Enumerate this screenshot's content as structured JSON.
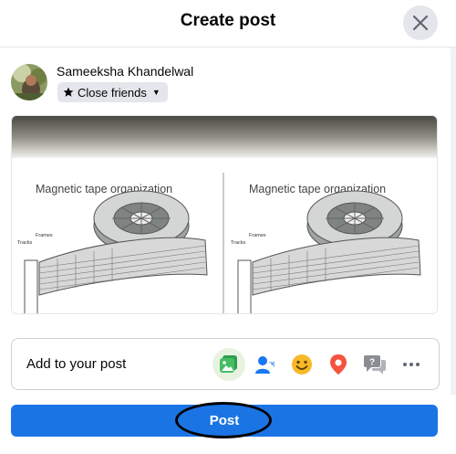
{
  "dialog": {
    "title": "Create post"
  },
  "author": {
    "name": "Sameeksha Khandelwal",
    "audience": "Close friends"
  },
  "media": {
    "panels": [
      {
        "caption": "Magnetic tape organization",
        "label_frames": "Frames",
        "label_tracks": "Tracks"
      },
      {
        "caption": "Magnetic tape organization",
        "label_frames": "Frames",
        "label_tracks": "Tracks"
      }
    ]
  },
  "add_to_post": {
    "label": "Add to your post",
    "tools": [
      "photo-video-icon",
      "tag-people-icon",
      "feeling-activity-icon",
      "check-in-icon",
      "ask-question-icon",
      "more-icon"
    ]
  },
  "actions": {
    "post_label": "Post"
  },
  "colors": {
    "primary": "#1b74e4",
    "photo_green": "#45bd62",
    "tag_blue": "#1877f2",
    "feeling_yellow": "#f7b928",
    "checkin_red": "#f5533d",
    "qna_gray": "#8a8d91"
  }
}
